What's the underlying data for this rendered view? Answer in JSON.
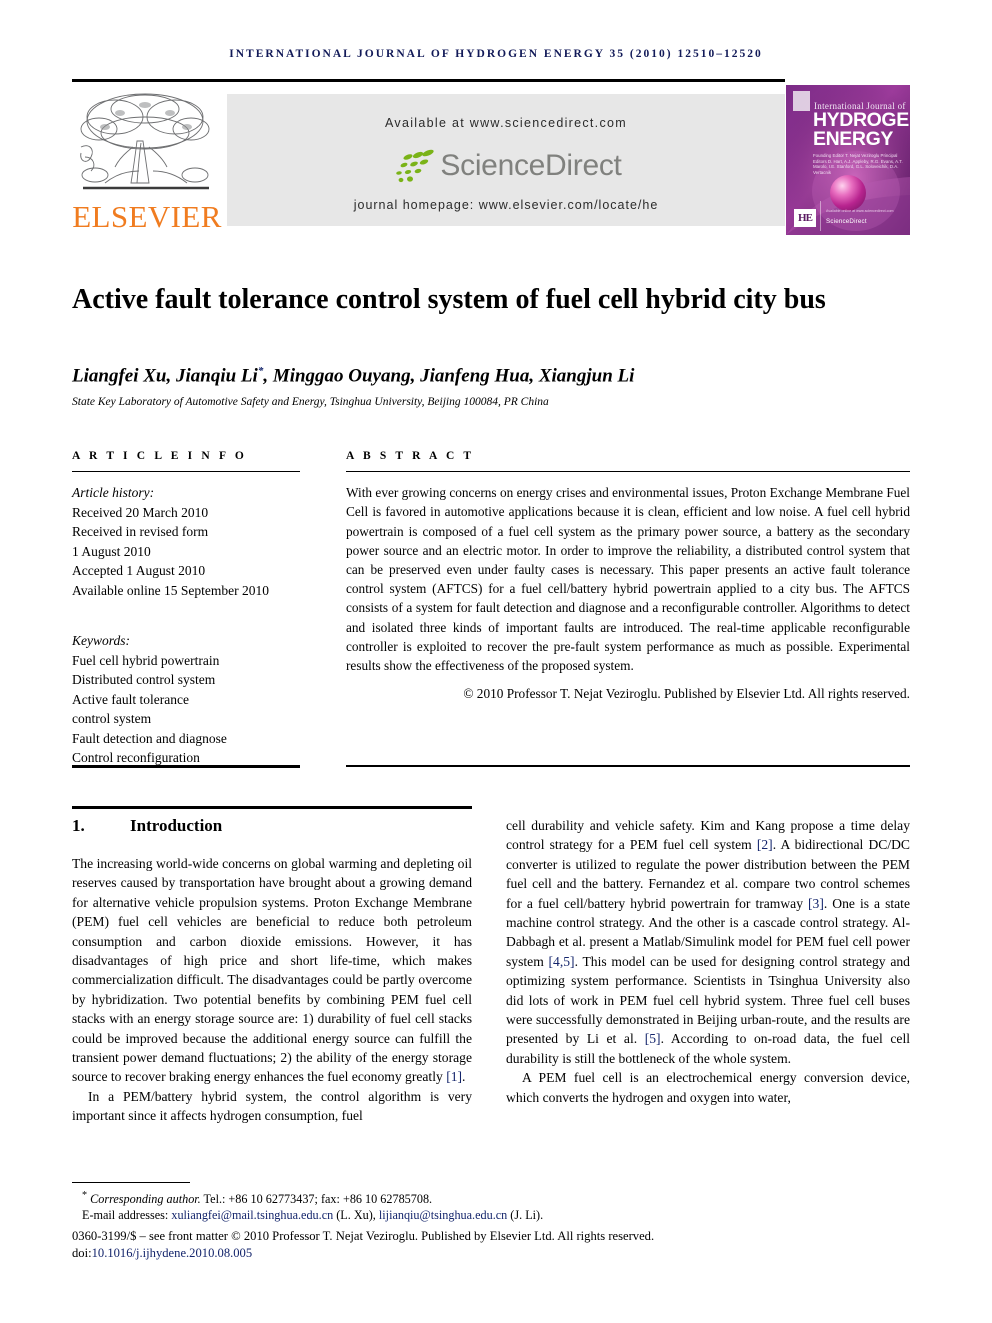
{
  "masthead": {
    "journal_line": "INTERNATIONAL JOURNAL OF HYDROGEN ENERGY 35 (2010) 12510–12520",
    "publisher_name": "ELSEVIER",
    "available_at": "Available at www.sciencedirect.com",
    "sciencedirect_word": "ScienceDirect",
    "journal_homepage": "journal homepage: www.elsevier.com/locate/he"
  },
  "cover": {
    "top_label": "International Journal of",
    "title_line1": "HYDROGEN",
    "title_line2": "ENERGY",
    "editors": "Founding Editor    T. Nejat Veziroglu\nPrincipal Editors   D. Hart, A.J. Appleby, R.G. Evans,\nA.T. Marolo, I.E. Stanford,\nG.L. Soloveichik, D.A. Vertacnik",
    "badge": "HE",
    "sciencedirect_small": "ScienceDirect",
    "sciencedirect_tag": "Available online at www.sciencedirect.com"
  },
  "article": {
    "title": "Active fault tolerance control system of fuel cell hybrid city bus",
    "authors": "Liangfei Xu, Jianqiu Li",
    "authors_rest": ", Minggao Ouyang, Jianfeng Hua, Xiangjun Li",
    "corresponding_marker": "*",
    "affiliation": "State Key Laboratory of Automotive Safety and Energy, Tsinghua University, Beijing 100084, PR China"
  },
  "article_info": {
    "label": "A R T I C L E   I N F O",
    "history_label": "Article history:",
    "history": [
      "Received 20 March 2010",
      "Received in revised form",
      "1 August 2010",
      "Accepted 1 August 2010",
      "Available online 15 September 2010"
    ],
    "keywords_label": "Keywords:",
    "keywords": [
      "Fuel cell hybrid powertrain",
      "Distributed control system",
      "Active fault tolerance",
      "control system",
      "Fault detection and diagnose",
      "Control reconfiguration"
    ]
  },
  "abstract": {
    "label": "A B S T R A C T",
    "text": "With ever growing concerns on energy crises and environmental issues, Proton Exchange Membrane Fuel Cell is favored in automotive applications because it is clean, efficient and low noise. A fuel cell hybrid powertrain is composed of a fuel cell system as the primary power source, a battery as the secondary power source and an electric motor. In order to improve the reliability, a distributed control system that can be preserved even under faulty cases is necessary. This paper presents an active fault tolerance control system (AFTCS) for a fuel cell/battery hybrid powertrain applied to a city bus. The AFTCS consists of a system for fault detection and diagnose and a reconfigurable controller. Algorithms to detect and isolated three kinds of important faults are introduced. The real-time applicable reconfigurable controller is exploited to recover the pre-fault system performance as much as possible. Experimental results show the effectiveness of the proposed system.",
    "copyright": "© 2010 Professor T. Nejat Veziroglu. Published by Elsevier Ltd. All rights reserved."
  },
  "body": {
    "section_number": "1.",
    "section_title": "Introduction",
    "left_paragraph_1": "The increasing world-wide concerns on global warming and depleting oil reserves caused by transportation have brought about a growing demand for alternative vehicle propulsion systems. Proton Exchange Membrane (PEM) fuel cell vehicles are beneficial to reduce both petroleum consumption and carbon dioxide emissions. However, it has disadvantages of high price and short life-time, which makes commercialization difficult. The disadvantages could be partly overcome by hybridization. Two potential benefits by combining PEM fuel cell stacks with an energy storage source are: 1) durability of fuel cell stacks could be improved because the additional energy source can fulfill the transient power demand fluctuations; 2) the ability of the energy storage source to recover braking energy enhances the fuel economy greatly ",
    "left_ref_1": "[1]",
    "left_paragraph_1_end": ".",
    "left_paragraph_2": "In a PEM/battery hybrid system, the control algorithm is very important since it affects hydrogen consumption, fuel",
    "right_p1_a": "cell durability and vehicle safety. Kim and Kang propose a time delay control strategy for a PEM fuel cell system ",
    "right_ref_2": "[2]",
    "right_p1_b": ". A bidirectional DC/DC converter is utilized to regulate the power distribution between the PEM fuel cell and the battery. Fernandez et al. compare two control schemes for a fuel cell/battery hybrid powertrain for tramway ",
    "right_ref_3": "[3]",
    "right_p1_c": ". One is a state machine control strategy. And the other is a cascade control strategy. Al-Dabbagh et al. present a Matlab/Simulink model for PEM fuel cell power system ",
    "right_ref_4": "[4,5]",
    "right_p1_d": ". This model can be used for designing control strategy and optimizing system performance. Scientists in Tsinghua University also did lots of work in PEM fuel cell hybrid system. Three fuel cell buses were successfully demonstrated in Beijing urban-route, and the results are presented by Li et al. ",
    "right_ref_5": "[5]",
    "right_p1_e": ". According to on-road data, the fuel cell durability is still the bottleneck of the whole system.",
    "right_p2": "A PEM fuel cell is an electrochemical energy conversion device, which converts the hydrogen and oxygen into water,"
  },
  "footer": {
    "corresponding_marker": "*",
    "corresponding_label": "Corresponding author.",
    "corresponding_contact": " Tel.: +86 10 62773437; fax: +86 10 62785708.",
    "email_label": "E-mail addresses:",
    "email_1": "xuliangfei@mail.tsinghua.edu.cn",
    "email_1_owner": " (L. Xu), ",
    "email_2": "lijianqiu@tsinghua.edu.cn",
    "email_2_owner": " (J. Li).",
    "front_matter": "0360-3199/$ – see front matter © 2010 Professor T. Nejat Veziroglu. Published by Elsevier Ltd. All rights reserved.",
    "doi_label": "doi:",
    "doi_value": "10.1016/j.ijhydene.2010.08.005"
  },
  "colors": {
    "journal_navy": "#121a58",
    "elsevier_orange": "#f07c20",
    "sciencedirect_green": "#7ab317",
    "sciencedirect_gray": "#80817e",
    "link_navy": "#13246b",
    "panel_gray": "#e7e7e7",
    "cover_purple": "#5b1b63"
  }
}
